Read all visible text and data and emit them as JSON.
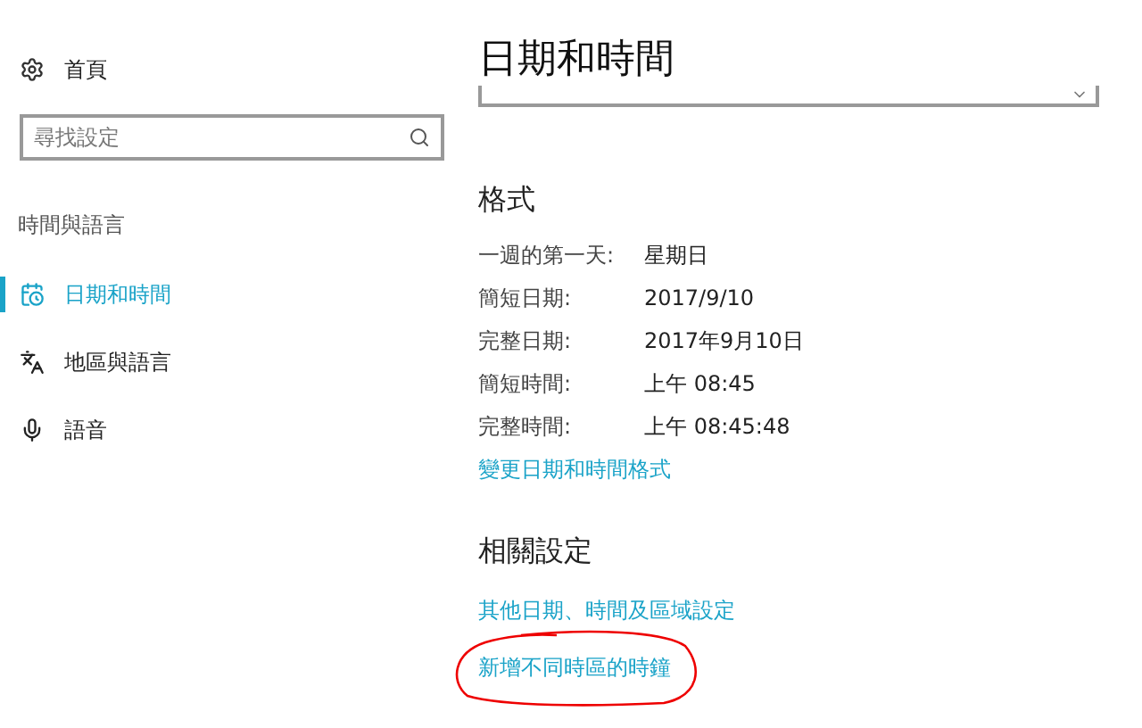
{
  "sidebar": {
    "home": {
      "label": "首頁"
    },
    "search": {
      "placeholder": "尋找設定"
    },
    "section_title": "時間與語言",
    "items": [
      {
        "label": "日期和時間",
        "kind": "clock",
        "selected": true
      },
      {
        "label": "地區與語言",
        "kind": "language",
        "selected": false
      },
      {
        "label": "語音",
        "kind": "mic",
        "selected": false
      }
    ]
  },
  "page": {
    "title": "日期和時間",
    "format": {
      "heading": "格式",
      "rows": [
        {
          "label": "一週的第一天:",
          "value": "星期日"
        },
        {
          "label": "簡短日期:",
          "value": "2017/9/10"
        },
        {
          "label": "完整日期:",
          "value": "2017年9月10日"
        },
        {
          "label": "簡短時間:",
          "value": "上午 08:45"
        },
        {
          "label": "完整時間:",
          "value": "上午 08:45:48"
        }
      ],
      "link": "變更日期和時間格式"
    },
    "related": {
      "heading": "相關設定",
      "links": [
        {
          "label": "其他日期、時間及區域設定",
          "circled": false
        },
        {
          "label": "新增不同時區的時鐘",
          "circled": true
        }
      ]
    }
  }
}
